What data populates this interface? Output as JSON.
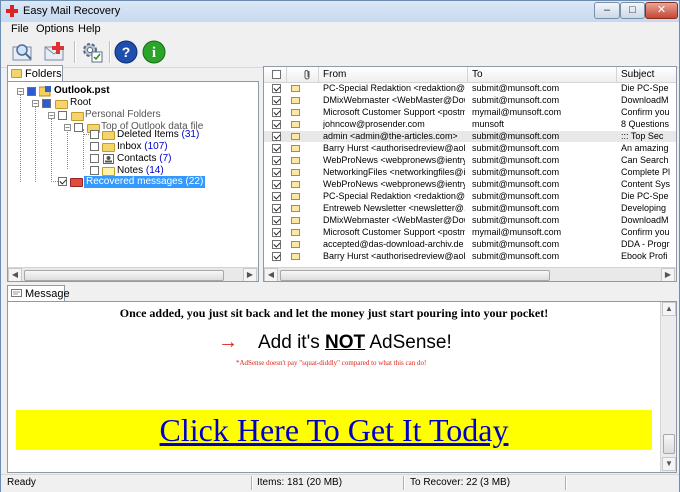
{
  "window": {
    "title": "Easy Mail Recovery"
  },
  "window_controls": {
    "minimize": "–",
    "maximize": "□",
    "close": "✕"
  },
  "menu": [
    "File",
    "Options",
    "Help"
  ],
  "toolbar": {
    "buttons": [
      "scan-icon",
      "add-icon",
      "settings-icon",
      "help-icon",
      "info-icon"
    ],
    "help_glyph": "?",
    "info_glyph": "i"
  },
  "folders_tab": {
    "label": "Folders"
  },
  "tree": {
    "expander_minus": "−",
    "root_file": "Outlook.pst",
    "root": "Root",
    "personal": "Personal Folders",
    "top": "Top of Outlook data file",
    "items": [
      {
        "name": "Deleted Items",
        "count": "(31)"
      },
      {
        "name": "Inbox",
        "count": "(107)"
      },
      {
        "name": "Contacts",
        "count": "(7)"
      },
      {
        "name": "Notes",
        "count": "(14)"
      }
    ],
    "recovered": "Recovered messages (22)"
  },
  "list": {
    "columns": {
      "from": "From",
      "to": "To",
      "subject": "Subject"
    },
    "rows": [
      {
        "from": "PC-Special Redaktion <redaktion@p...",
        "to": "submit@munsoft.com",
        "subject": "Die PC-Spe"
      },
      {
        "from": "DMixWebmaster <WebMaster@Dow...",
        "to": "submit@munsoft.com",
        "subject": "DownloadM"
      },
      {
        "from": "Microsoft Customer Support <postm...",
        "to": "mymail@munsoft.com",
        "subject": "Confirm you"
      },
      {
        "from": "johncow@prosender.com",
        "to": "munsoft",
        "subject": "8 Questions"
      },
      {
        "from": "admin <admin@the-articles.com>",
        "to": "submit@munsoft.com",
        "subject": "::: Top Sec"
      },
      {
        "from": "Barry Hurst <authorisedreview@aol...",
        "to": "submit@munsoft.com",
        "subject": "An amazing"
      },
      {
        "from": "WebProNews <webpronews@ientry....",
        "to": "submit@munsoft.com",
        "subject": "Can Search"
      },
      {
        "from": "NetworkingFiles <networkingfiles@ie...",
        "to": "submit@munsoft.com",
        "subject": "Complete Pl"
      },
      {
        "from": "WebProNews <webpronews@ientry....",
        "to": "submit@munsoft.com",
        "subject": "Content Sys"
      },
      {
        "from": "PC-Special Redaktion <redaktion@p...",
        "to": "submit@munsoft.com",
        "subject": "Die PC-Spe"
      },
      {
        "from": "Entreweb Newsletter <newsletter@...",
        "to": "submit@munsoft.com",
        "subject": "Developing"
      },
      {
        "from": "DMixWebmaster <WebMaster@Dow...",
        "to": "submit@munsoft.com",
        "subject": "DownloadM"
      },
      {
        "from": "Microsoft Customer Support <postm...",
        "to": "mymail@munsoft.com",
        "subject": "Confirm you"
      },
      {
        "from": "accepted@das-download-archiv.de",
        "to": "submit@munsoft.com",
        "subject": "DDA - Progr"
      },
      {
        "from": "Barry Hurst <authorisedreview@aol...",
        "to": "submit@munsoft.com",
        "subject": "Ebook Profi"
      }
    ]
  },
  "message_tab": {
    "label": "Message"
  },
  "message": {
    "line1": "Once added, you just sit back and let the money just start pouring into your pocket!",
    "headline_pre": "Add it's ",
    "headline_bold": "NOT",
    "headline_post": " AdSense!",
    "arrow": "→",
    "small_note": "*AdSense doesn't pay \"squat-diddly\" compared to what this can do!",
    "cta": "Click Here To Get It Today"
  },
  "status": {
    "state": "Ready",
    "items": "Items: 181 (20 MB)",
    "recover": "To Recover: 22 (3 MB)"
  },
  "colors": {
    "selection": "#3399ff",
    "cta_bg": "#ffff00",
    "cta_text": "#0000cc",
    "count": "#0000cc"
  }
}
